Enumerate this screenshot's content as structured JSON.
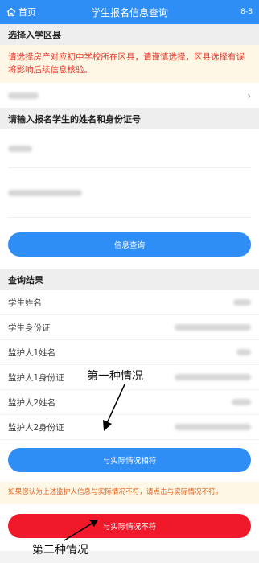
{
  "topbar": {
    "home_label": "首页",
    "title": "学生报名信息查询",
    "code": "8-8"
  },
  "district": {
    "header": "选择入学区县",
    "warning": "请选择房产对应初中学校所在区县，请谨慎选择，区县选择有误将影响后续信息核验。"
  },
  "identity": {
    "header": "请输入报名学生的姓名和身份证号"
  },
  "query_button": "信息查询",
  "results": {
    "header": "查询结果",
    "rows": [
      {
        "label": "学生姓名"
      },
      {
        "label": "学生身份证"
      },
      {
        "label": "监护人1姓名"
      },
      {
        "label": "监护人1身份证"
      },
      {
        "label": "监护人2姓名"
      },
      {
        "label": "监护人2身份证"
      }
    ]
  },
  "match_button": "与实际情况相符",
  "mismatch_notice": "如果您认为上述监护人信息与实际情况不符，请点击与实际情况不符。",
  "mismatch_button": "与实际情况不符",
  "annotations": {
    "first": "第一种情况",
    "second": "第二种情况"
  }
}
